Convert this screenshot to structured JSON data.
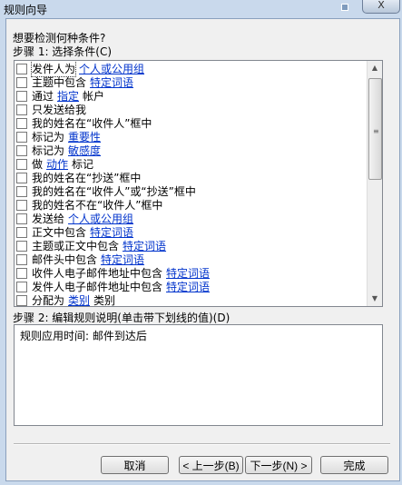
{
  "window": {
    "title": "规则向导",
    "close_label": "X"
  },
  "step_question": "想要检测何种条件?",
  "step1_label": "步骤 1: 选择条件(C)",
  "conditions": [
    {
      "parts": [
        {
          "t": "发件人为",
          "link": false
        },
        {
          "t": "个人或公用组",
          "link": true
        }
      ]
    },
    {
      "parts": [
        {
          "t": "主题中包含",
          "link": false
        },
        {
          "t": "特定词语",
          "link": true
        }
      ]
    },
    {
      "parts": [
        {
          "t": "通过",
          "link": false
        },
        {
          "t": "指定",
          "link": true
        },
        {
          "t": "帐户",
          "link": false
        }
      ]
    },
    {
      "parts": [
        {
          "t": "只发送给我",
          "link": false
        }
      ]
    },
    {
      "parts": [
        {
          "t": "我的姓名在“收件人”框中",
          "link": false
        }
      ]
    },
    {
      "parts": [
        {
          "t": "标记为",
          "link": false
        },
        {
          "t": "重要性",
          "link": true
        }
      ]
    },
    {
      "parts": [
        {
          "t": "标记为",
          "link": false
        },
        {
          "t": "敏感度",
          "link": true
        }
      ]
    },
    {
      "parts": [
        {
          "t": "做",
          "link": false
        },
        {
          "t": "动作",
          "link": true
        },
        {
          "t": "标记",
          "link": false
        }
      ]
    },
    {
      "parts": [
        {
          "t": "我的姓名在“抄送”框中",
          "link": false
        }
      ]
    },
    {
      "parts": [
        {
          "t": "我的姓名在“收件人”或“抄送”框中",
          "link": false
        }
      ]
    },
    {
      "parts": [
        {
          "t": "我的姓名不在“收件人”框中",
          "link": false
        }
      ]
    },
    {
      "parts": [
        {
          "t": "发送给",
          "link": false
        },
        {
          "t": "个人或公用组",
          "link": true
        }
      ]
    },
    {
      "parts": [
        {
          "t": "正文中包含",
          "link": false
        },
        {
          "t": "特定词语",
          "link": true
        }
      ]
    },
    {
      "parts": [
        {
          "t": "主题或正文中包含",
          "link": false
        },
        {
          "t": "特定词语",
          "link": true
        }
      ]
    },
    {
      "parts": [
        {
          "t": "邮件头中包含",
          "link": false
        },
        {
          "t": "特定词语",
          "link": true
        }
      ]
    },
    {
      "parts": [
        {
          "t": "收件人电子邮件地址中包含",
          "link": false
        },
        {
          "t": "特定词语",
          "link": true
        }
      ]
    },
    {
      "parts": [
        {
          "t": "发件人电子邮件地址中包含",
          "link": false
        },
        {
          "t": "特定词语",
          "link": true
        }
      ]
    },
    {
      "parts": [
        {
          "t": "分配为",
          "link": false
        },
        {
          "t": "类别",
          "link": true
        },
        {
          "t": "类别",
          "link": false
        }
      ]
    }
  ],
  "step2_label": "步骤 2: 编辑规则说明(单击带下划线的值)(D)",
  "description_text": "规则应用时间: 邮件到达后",
  "buttons": {
    "cancel": "取消",
    "back": "< 上一步(B)",
    "next": "下一步(N) >",
    "finish": "完成"
  },
  "icons": {
    "scroll_up": "scroll-up-icon",
    "scroll_down": "scroll-down-icon",
    "grip": "scroll-grip-icon"
  }
}
